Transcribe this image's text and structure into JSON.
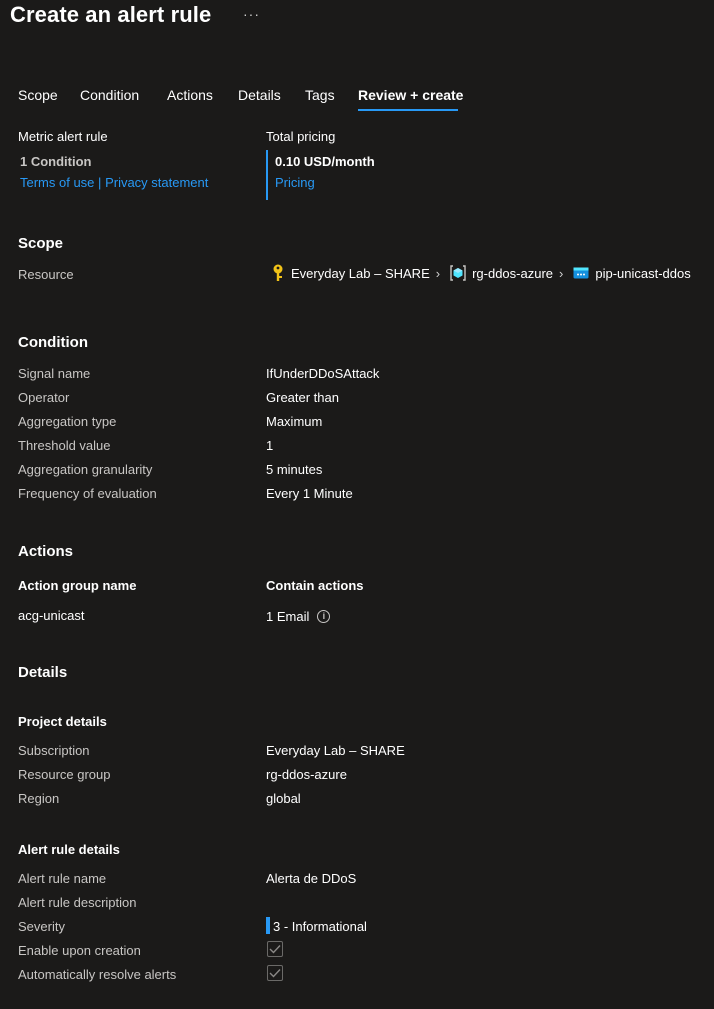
{
  "header": {
    "title": "Create an alert rule",
    "more": "···"
  },
  "tabs": [
    "Scope",
    "Condition",
    "Actions",
    "Details",
    "Tags",
    "Review + create"
  ],
  "summary": {
    "rule_type": "Metric alert rule",
    "condition_count": "1 Condition",
    "terms": "Terms of use",
    "sep": "|",
    "privacy": "Privacy statement",
    "pricing_label": "Total pricing",
    "price": "0.10 USD/month",
    "pricing_link": "Pricing"
  },
  "scope": {
    "heading": "Scope",
    "resource_label": "Resource",
    "crumbs": [
      "Everyday Lab – SHARE",
      "rg-ddos-azure",
      "pip-unicast-ddos"
    ]
  },
  "condition": {
    "heading": "Condition",
    "rows": [
      {
        "label": "Signal name",
        "value": "IfUnderDDoSAttack"
      },
      {
        "label": "Operator",
        "value": "Greater than"
      },
      {
        "label": "Aggregation type",
        "value": "Maximum"
      },
      {
        "label": "Threshold value",
        "value": "1"
      },
      {
        "label": "Aggregation granularity",
        "value": "5 minutes"
      },
      {
        "label": "Frequency of evaluation",
        "value": "Every 1 Minute"
      }
    ]
  },
  "actions": {
    "heading": "Actions",
    "col1": "Action group name",
    "col2": "Contain actions",
    "group_name": "acg-unicast",
    "contains": "1 Email"
  },
  "details": {
    "heading": "Details",
    "project_heading": "Project details",
    "project_rows": [
      {
        "label": "Subscription",
        "value": "Everyday Lab – SHARE"
      },
      {
        "label": "Resource group",
        "value": "rg-ddos-azure"
      },
      {
        "label": "Region",
        "value": "global"
      }
    ],
    "alert_heading": "Alert rule details",
    "alert_name_label": "Alert rule name",
    "alert_name": "Alerta de DDoS",
    "alert_desc_label": "Alert rule description",
    "severity_label": "Severity",
    "severity": "3 - Informational",
    "enable_label": "Enable upon creation",
    "resolve_label": "Automatically resolve alerts"
  },
  "colors": {
    "accent": "#2899f5",
    "background": "#1b1a19"
  },
  "icons": {
    "subscription": "key-icon",
    "resource_group": "resource-group-icon",
    "resource": "public-ip-icon"
  }
}
